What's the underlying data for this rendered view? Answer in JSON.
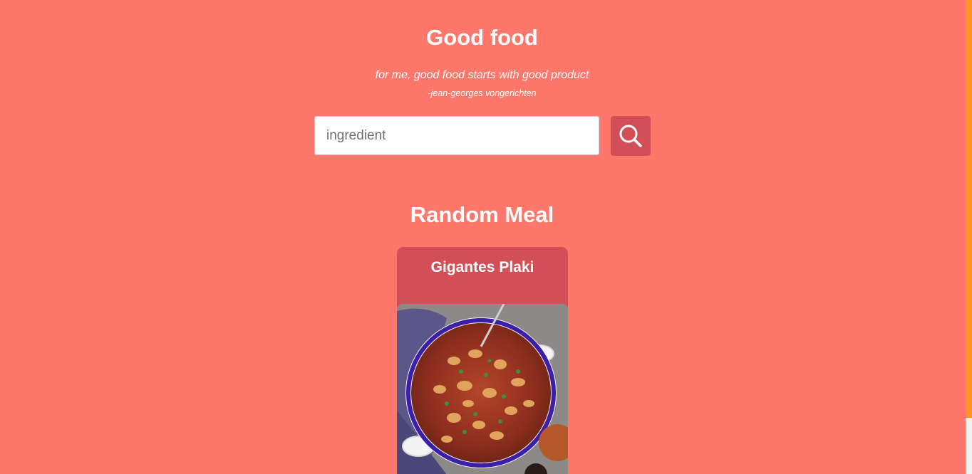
{
  "header": {
    "title": "Good food",
    "quote": "for me, good food starts with good product",
    "author": "-jean-georges vongerichten"
  },
  "search": {
    "placeholder": "ingredient",
    "value": "",
    "button_icon": "search-icon"
  },
  "random_meal": {
    "heading": "Random Meal",
    "meal_name": "Gigantes Plaki",
    "image_icon": "meal-photo"
  },
  "colors": {
    "background": "#ff766a",
    "accent": "#d34f57",
    "text": "#ffffff",
    "scrollbar_thumb": "#ff9422"
  }
}
